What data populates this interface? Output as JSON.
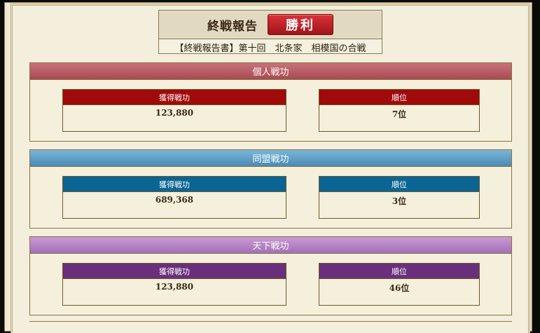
{
  "header": {
    "title": "終戦報告",
    "result": "勝利",
    "subtitle": "【終戦報告書】第十回　北条家　相模国の合戦"
  },
  "sections": [
    {
      "title": "個人戦功",
      "color": "#a00a0a",
      "merit_label": "獲得戦功",
      "merit_value": "123,880",
      "rank_label": "順位",
      "rank_value": "7位"
    },
    {
      "title": "同盟戦功",
      "color": "#0a6494",
      "merit_label": "獲得戦功",
      "merit_value": "689,368",
      "rank_label": "順位",
      "rank_value": "3位"
    },
    {
      "title": "天下戦功",
      "color": "#6a2f7c",
      "merit_label": "獲得戦功",
      "merit_value": "123,880",
      "rank_label": "順位",
      "rank_value": "46位"
    }
  ]
}
